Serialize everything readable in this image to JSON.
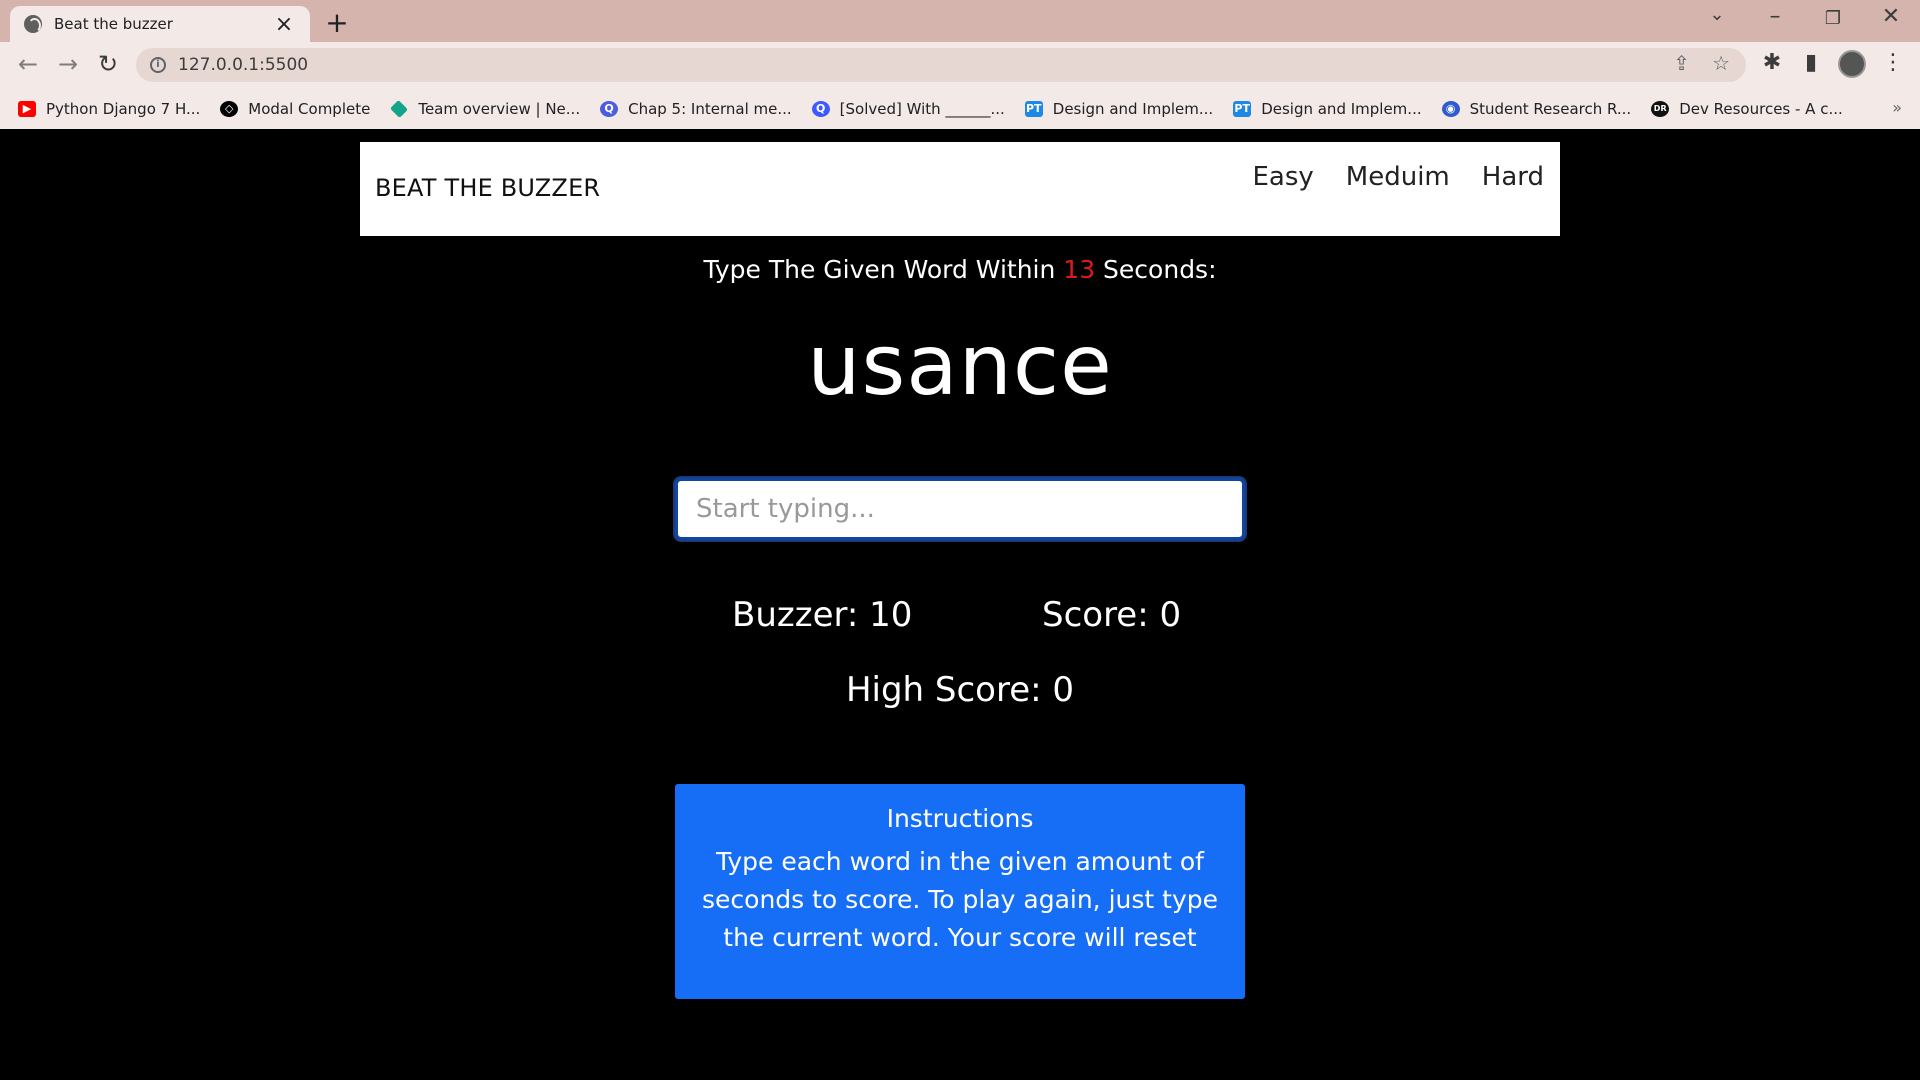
{
  "browser": {
    "tab_title": "Beat the buzzer",
    "url": "127.0.0.1:5500",
    "bookmarks": [
      {
        "label": "Python Django 7 H...",
        "icon": "youtube-icon",
        "color": "#ff0000"
      },
      {
        "label": "Modal Complete",
        "icon": "codepen-icon",
        "color": "#000000"
      },
      {
        "label": "Team overview | Ne...",
        "icon": "diamond-icon",
        "color": "#14a38b"
      },
      {
        "label": "Chap 5: Internal me...",
        "icon": "q-icon",
        "color": "#4c5be0"
      },
      {
        "label": "[Solved] With ______...",
        "icon": "search-q-icon",
        "color": "#3d5afe"
      },
      {
        "label": "Design and Implem...",
        "icon": "pt-icon",
        "color": "#1e88e5"
      },
      {
        "label": "Design and Implem...",
        "icon": "pt-icon",
        "color": "#1e88e5"
      },
      {
        "label": "Student Research R...",
        "icon": "globe-icon",
        "color": "#2e5bd0"
      },
      {
        "label": "Dev Resources - A c...",
        "icon": "dr-icon",
        "color": "#111111"
      }
    ]
  },
  "nav": {
    "brand": "BEAT THE BUZZER",
    "links": [
      "Easy",
      "Meduim",
      "Hard"
    ]
  },
  "game": {
    "prompt_prefix": "Type The Given Word Within ",
    "seconds": "13",
    "prompt_suffix": " Seconds:",
    "current_word": "usance",
    "input_placeholder": "Start typing...",
    "buzzer": "Buzzer: 10",
    "score": "Score: 0",
    "high_score": "High Score: 0"
  },
  "instructions": {
    "title": "Instructions",
    "body": "Type each word in the given amount of seconds to score. To play again, just type the current word. Your score will reset"
  },
  "colors": {
    "accent_red": "#e0191b",
    "instructions_bg": "#166df6"
  }
}
